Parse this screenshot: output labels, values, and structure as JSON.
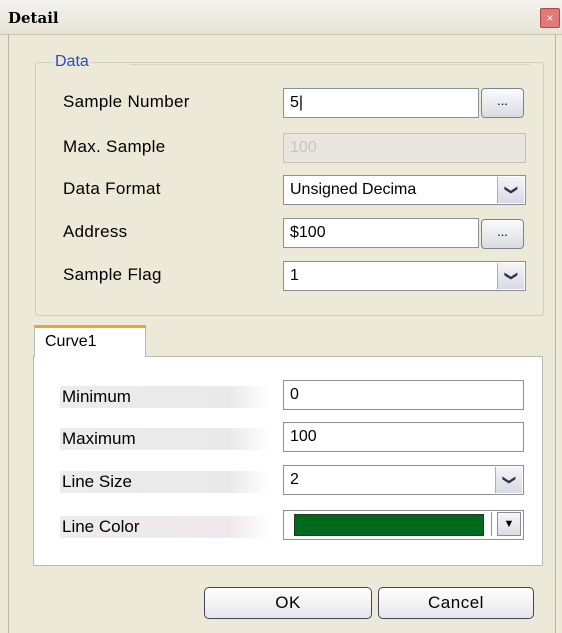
{
  "window": {
    "title": "Detail",
    "close_glyph": "×"
  },
  "data_group": {
    "legend": "Data",
    "sample_number": {
      "label": "Sample Number",
      "value": "5|",
      "button": "..."
    },
    "max_sample": {
      "label": "Max. Sample",
      "value": "100"
    },
    "data_format": {
      "label": "Data Format",
      "value": "Unsigned Decima"
    },
    "address": {
      "label": "Address",
      "value": "$100",
      "button": "..."
    },
    "sample_flag": {
      "label": "Sample Flag",
      "value": "1"
    }
  },
  "tabs": [
    {
      "label": "Curve1"
    }
  ],
  "curve": {
    "minimum": {
      "label": "Minimum",
      "value": "0"
    },
    "maximum": {
      "label": "Maximum",
      "value": "100"
    },
    "line_size": {
      "label": "Line Size",
      "value": "2"
    },
    "line_color": {
      "label": "Line Color",
      "color": "#006a1c"
    }
  },
  "arrows": {
    "combo": "❯",
    "color": "▼"
  },
  "buttons": {
    "ok": "OK",
    "cancel": "Cancel"
  },
  "colors": {
    "accent_tab": "#f0a22e",
    "legend": "#2150b8"
  },
  "icons": {
    "combo_arrow": "chevron-down-icon",
    "close": "close-icon"
  }
}
